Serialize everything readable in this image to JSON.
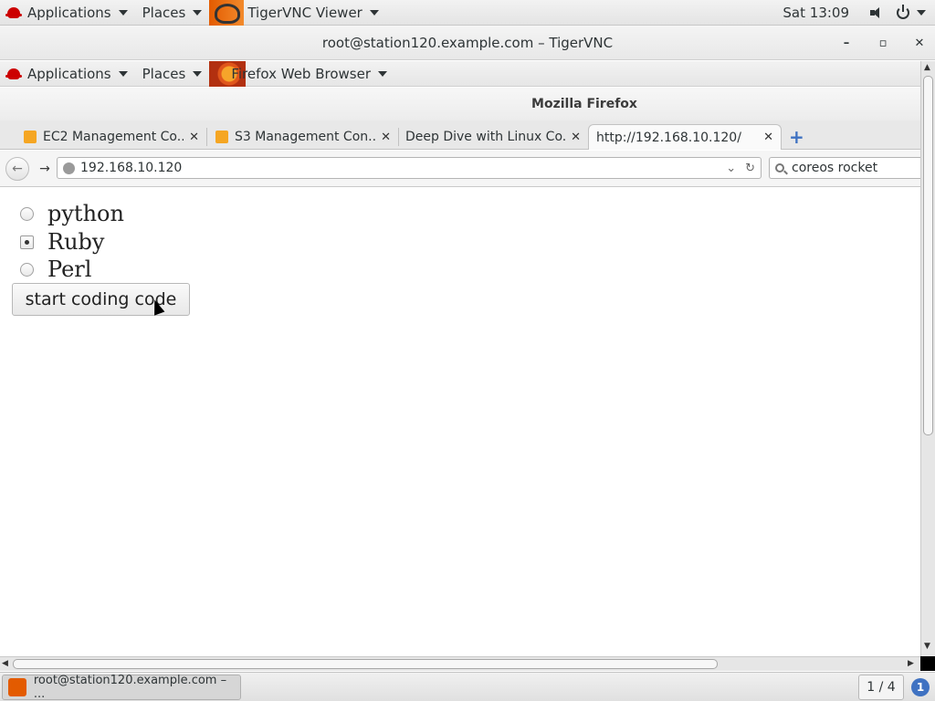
{
  "outer_topbar": {
    "applications": "Applications",
    "places": "Places",
    "active_app": "TigerVNC Viewer",
    "clock": "Sat 13:09"
  },
  "vnc_window": {
    "title": "root@station120.example.com – TigerVNC",
    "minimize": "–",
    "maximize": "▫",
    "close": "✕"
  },
  "inner_topbar": {
    "applications": "Applications",
    "places": "Places",
    "active_app": "Firefox Web Browser"
  },
  "firefox": {
    "window_title": "Mozilla Firefox",
    "tabs": [
      {
        "label": "EC2 Management Co..."
      },
      {
        "label": "S3 Management Con..."
      },
      {
        "label": "Deep Dive with Linux Co..."
      },
      {
        "label": "http://192.168.10.120/"
      }
    ],
    "url": "192.168.10.120",
    "search": "coreos rocket"
  },
  "page": {
    "options": [
      {
        "label": "python",
        "checked": false
      },
      {
        "label": "Ruby",
        "checked": true
      },
      {
        "label": "Perl",
        "checked": false
      }
    ],
    "button_label": "start coding code"
  },
  "taskbar": {
    "window_item": "root@station120.example.com – ...",
    "workspace": "1 / 4",
    "badge": "1"
  }
}
